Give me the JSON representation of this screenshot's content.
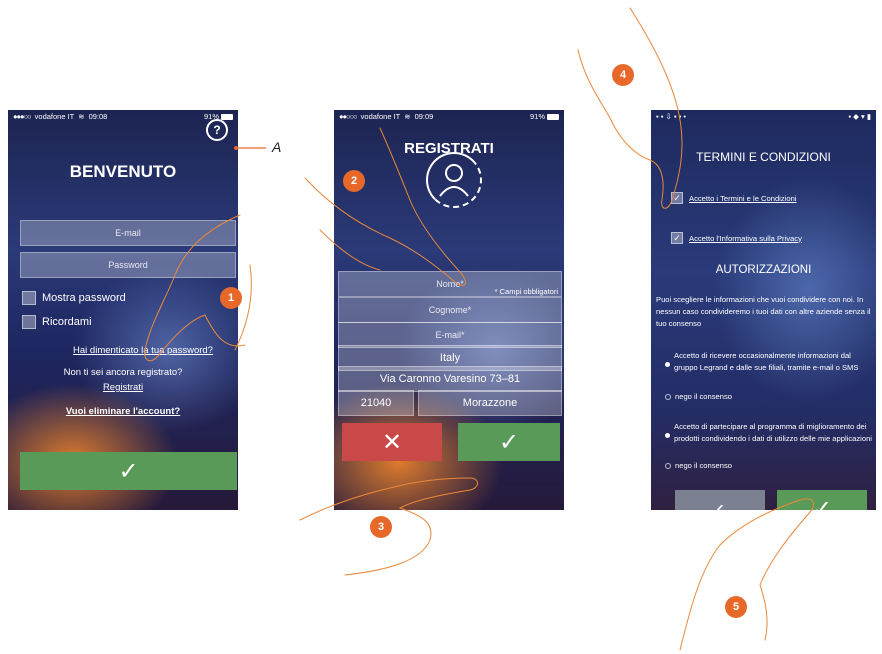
{
  "callout_label": "A",
  "steps": [
    "1",
    "2",
    "3",
    "4",
    "5"
  ],
  "screen1": {
    "status": {
      "carrier": "vodafone IT",
      "time": "09:08",
      "battery": "91%"
    },
    "title": "BENVENUTO",
    "help_glyph": "?",
    "email_placeholder": "E-mail",
    "password_placeholder": "Password",
    "show_password": "Mostra password",
    "remember_me": "Ricordami",
    "forgot": "Hai dimenticato la tua password?",
    "not_registered": "Non ti sei ancora registrato?",
    "register": "Registrati",
    "delete_account": "Vuoi eliminare l'account?",
    "confirm_glyph": "✓"
  },
  "screen2": {
    "status": {
      "carrier": "vodafone IT",
      "time": "09:09",
      "battery": "91%"
    },
    "title": "REGISTRATI",
    "required_note": "* Campi obbligatori",
    "name_placeholder": "Nome*",
    "surname_placeholder": "Cognome*",
    "email_placeholder": "E-mail*",
    "country": "Italy",
    "address": "Via Caronno Varesino 73–81",
    "zip": "21040",
    "city": "Morazzone",
    "cancel_glyph": "✕",
    "confirm_glyph": "✓"
  },
  "screen3": {
    "title": "TERMINI E CONDIZIONI",
    "accept_terms": "Accetto i Termini e le Condizioni",
    "accept_privacy": "Accetto l'Informativa sulla Privacy",
    "auth_title": "AUTORIZZAZIONI",
    "auth_text": "Puoi scegliere le informazioni che vuoi condividere con noi. In nessun caso condivideremo i tuoi dati con altre aziende senza il tuo consenso",
    "option1": "Accetto di ricevere occasionalmente informazioni dal gruppo Legrand e dalle sue filiali, tramite e-mail o SMS",
    "deny1": "nego il consenso",
    "option2": "Accetto di partecipare al programma di miglioramento dei prodotti condividendo i dati di utilizzo delle mie applicazioni",
    "deny2": "nego il consenso",
    "back_glyph": "‹",
    "confirm_glyph": "✓"
  }
}
